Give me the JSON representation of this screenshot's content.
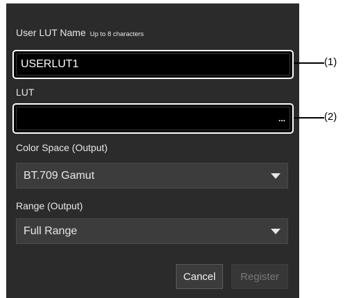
{
  "dialog": {
    "user_lut_name": {
      "label": "User LUT Name",
      "hint": "Up to 8 characters",
      "value": "USERLUT1"
    },
    "lut": {
      "label": "LUT",
      "value": "",
      "browse_label": "..."
    },
    "color_space": {
      "label": "Color Space (Output)",
      "selected": "BT.709 Gamut"
    },
    "range": {
      "label": "Range (Output)",
      "selected": "Full Range"
    },
    "buttons": {
      "cancel": "Cancel",
      "register": "Register"
    }
  },
  "callouts": {
    "one": "(1)",
    "two": "(2)"
  },
  "icons": {
    "dropdown": "chevron-down-icon",
    "browse": "ellipsis-icon"
  },
  "colors": {
    "dialog_bg": "#2b2b2b",
    "field_bg": "#000000",
    "select_bg": "#3c3c3c",
    "highlight": "#ffffff"
  }
}
